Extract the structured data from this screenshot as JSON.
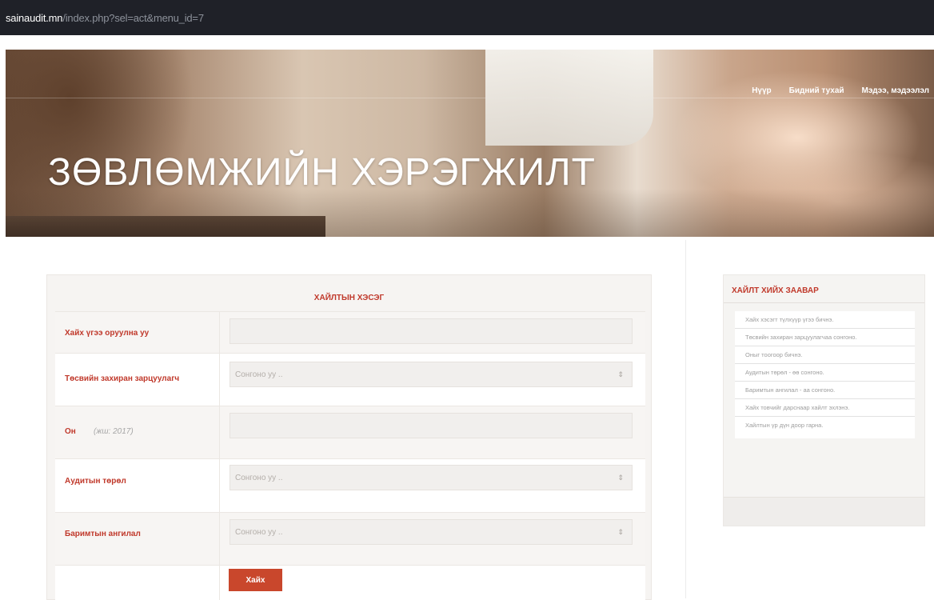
{
  "browser": {
    "url_host": "sainaudit.mn",
    "url_path": "/index.php?sel=act&menu_id=7"
  },
  "hero": {
    "title": "ЗӨВЛӨМЖИЙН ХЭРЭГЖИЛТ",
    "nav": [
      "Нүүр",
      "Бидний тухай",
      "Мэдээ, мэдээлэл"
    ]
  },
  "search_form": {
    "title": "ХАЙЛТЫН ХЭСЭГ",
    "keyword_label": "Хайх үгээ оруулна уу",
    "budget_label": "Төсвийн захиран зарцуулагч",
    "budget_placeholder": "Сонгоно уу ..",
    "year_label": "Он",
    "year_hint": "(жш: 2017)",
    "audit_type_label": "Аудитын төрөл",
    "audit_type_placeholder": "Сонгоно уу ..",
    "doc_category_label": "Баримтын ангилал",
    "doc_category_placeholder": "Сонгоно уу ..",
    "search_button": "Хайх"
  },
  "guide": {
    "title": "ХАЙЛТ ХИЙХ ЗААВАР",
    "steps": [
      "Хайх хэсэгт түлхүүр үгээ бичнэ.",
      "Төсвийн захиран зарцуулагчаа сонгоно.",
      "Оныг тоогоор бичнэ.",
      "Аудитын төрөл - өө сонгоно.",
      "Баримтын ангилал - аа сонгоно.",
      "Хайх товчийг дарснаар хайлт эхлэнэ.",
      "Хайлтын үр дүн доор гарна."
    ]
  },
  "colors": {
    "accent": "#c0392b",
    "button": "#c9472c"
  }
}
